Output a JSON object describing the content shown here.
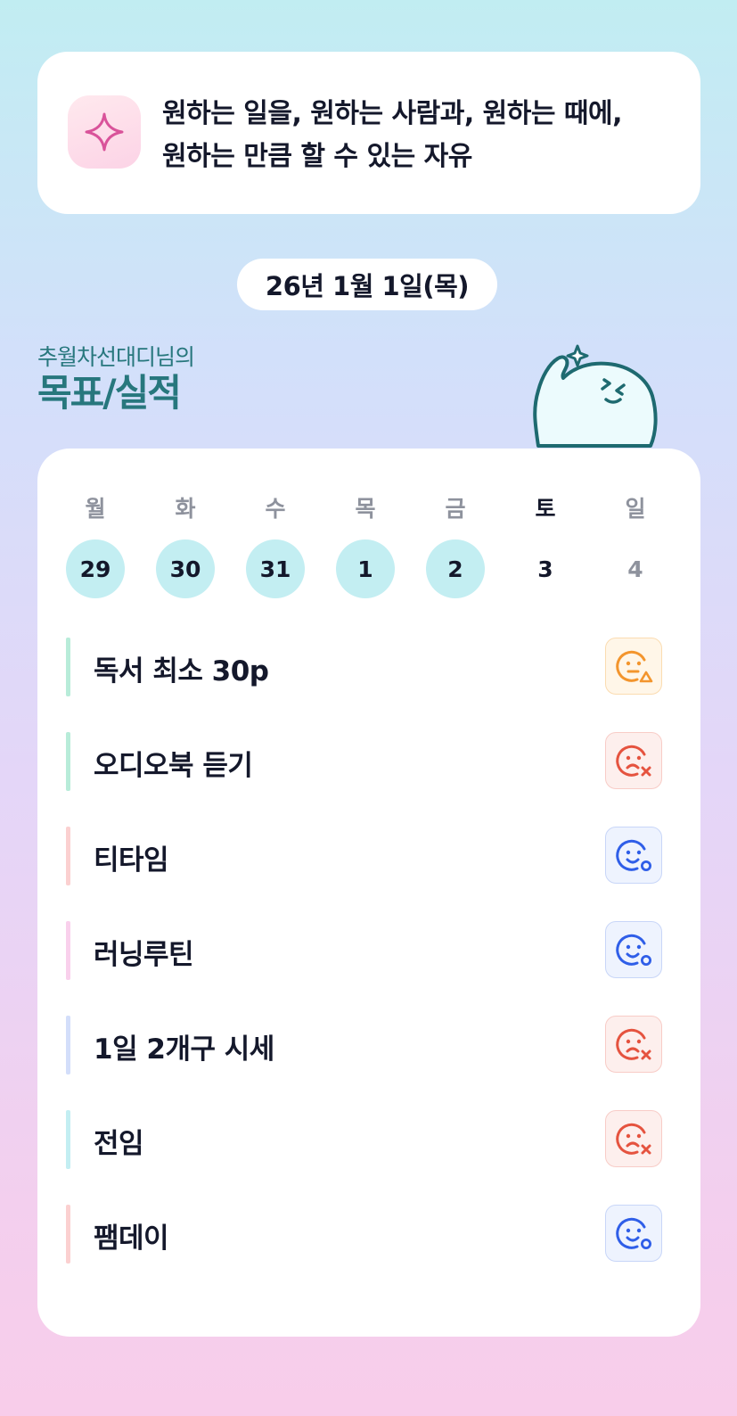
{
  "quote": {
    "icon": "sparkle-icon",
    "lines": [
      "원하는 일을, 원하는 사람과, 원하는 때에,",
      "원하는 만큼 할 수 있는 자유"
    ]
  },
  "date": "26년 1월 1일(목)",
  "goal_section": {
    "subtitle": "추월차선대디님의",
    "title": "목표/실적",
    "mascot_icon": "mascot-thumbs-up-icon"
  },
  "week": [
    {
      "label": "월",
      "num": "29",
      "state": "done"
    },
    {
      "label": "화",
      "num": "30",
      "state": "done"
    },
    {
      "label": "수",
      "num": "31",
      "state": "done"
    },
    {
      "label": "목",
      "num": "1",
      "state": "done"
    },
    {
      "label": "금",
      "num": "2",
      "state": "done"
    },
    {
      "label": "토",
      "num": "3",
      "state": "today"
    },
    {
      "label": "일",
      "num": "4",
      "state": "future"
    }
  ],
  "goals": [
    {
      "label": "독서 최소 30p",
      "status": "partial",
      "status_icon": "face-neutral-triangle-icon",
      "bar_color": "#b8ecd9"
    },
    {
      "label": "오디오북 듣기",
      "status": "fail",
      "status_icon": "face-sad-x-icon",
      "bar_color": "#b8ecd9"
    },
    {
      "label": "티타임",
      "status": "success",
      "status_icon": "face-happy-circle-icon",
      "bar_color": "#fbd0d0"
    },
    {
      "label": "러닝루틴",
      "status": "success",
      "status_icon": "face-happy-circle-icon",
      "bar_color": "#f9d0ec"
    },
    {
      "label": "1일 2개구 시세",
      "status": "fail",
      "status_icon": "face-sad-x-icon",
      "bar_color": "#d3defa"
    },
    {
      "label": "전임",
      "status": "fail",
      "status_icon": "face-sad-x-icon",
      "bar_color": "#c3eef2"
    },
    {
      "label": "팸데이",
      "status": "success",
      "status_icon": "face-happy-circle-icon",
      "bar_color": "#fbd0d0"
    }
  ],
  "colors": {
    "accent_teal": "#27777d",
    "partial": "#f3952d",
    "fail": "#e5533f",
    "success": "#2f5ee8"
  }
}
